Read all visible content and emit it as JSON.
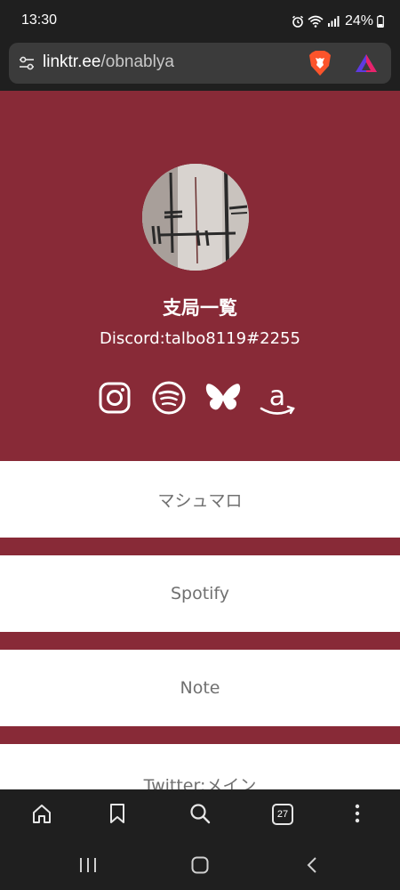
{
  "status_bar": {
    "time": "13:30",
    "battery": "24%",
    "icons": [
      "alarm-icon",
      "wifi-icon",
      "signal-icon",
      "battery-icon"
    ]
  },
  "browser": {
    "url_domain": "linktr.ee",
    "url_path": "/obnablya",
    "icons": [
      "site-settings-icon",
      "brave-shield-icon",
      "brave-rewards-icon"
    ]
  },
  "profile": {
    "name": "支局一覧",
    "bio": "Discord:talbo8119#2255",
    "social_icons": [
      "instagram-icon",
      "spotify-icon",
      "bluesky-icon",
      "amazon-icon"
    ]
  },
  "links": [
    {
      "label": "マシュマロ"
    },
    {
      "label": "Spotify"
    },
    {
      "label": "Note"
    },
    {
      "label": "Twitter:メイン"
    }
  ],
  "toolbar": {
    "tab_count": "27",
    "icons": [
      "home-icon",
      "bookmark-icon",
      "search-icon",
      "tabs-icon",
      "more-icon"
    ]
  },
  "navigation": {
    "icons": [
      "recent-apps-icon",
      "home-button-icon",
      "back-icon"
    ]
  },
  "colors": {
    "background": "#882a37",
    "button": "#ffffff",
    "button_text": "#707070",
    "system_bars": "#1f1f1f"
  }
}
